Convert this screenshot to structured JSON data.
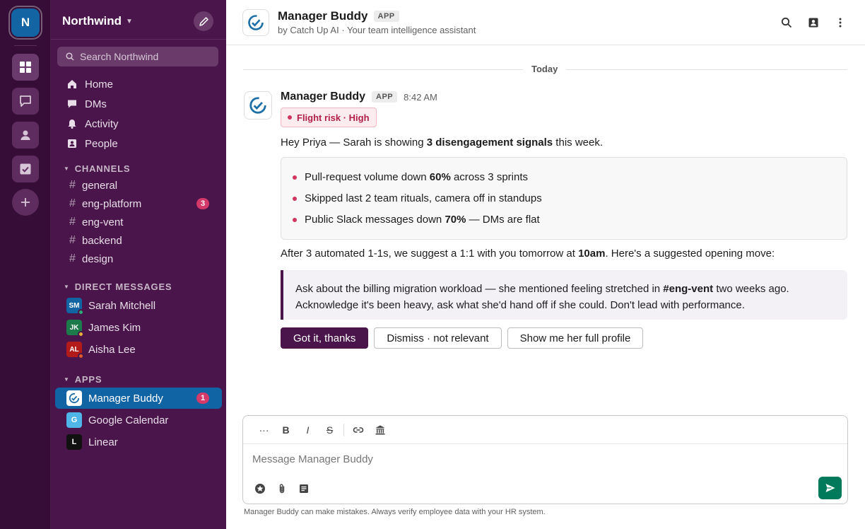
{
  "workspace": {
    "initial": "N",
    "name": "Northwind"
  },
  "search": {
    "placeholder": "Search Northwind"
  },
  "nav": [
    {
      "label": "Home",
      "icon": "home-icon"
    },
    {
      "label": "DMs",
      "icon": "chat-bubble-icon"
    },
    {
      "label": "Activity",
      "icon": "bell-icon"
    },
    {
      "label": "People",
      "icon": "contact-card-icon"
    }
  ],
  "channels": {
    "title": "CHANNELS",
    "items": [
      {
        "name": "general",
        "badge": ""
      },
      {
        "name": "eng-platform",
        "badge": "3"
      },
      {
        "name": "eng-vent",
        "badge": ""
      },
      {
        "name": "backend",
        "badge": ""
      },
      {
        "name": "design",
        "badge": ""
      }
    ]
  },
  "direct_messages": {
    "title": "DIRECT MESSAGES",
    "items": [
      {
        "initials": "SM",
        "name": "Sarah Mitchell",
        "color": "#1264a3",
        "status_color": "#2bac76"
      },
      {
        "initials": "JK",
        "name": "James Kim",
        "color": "#1d7a4a",
        "status_color": "#e8b03a"
      },
      {
        "initials": "AL",
        "name": "Aisha Lee",
        "color": "#b31b1b",
        "status_color": "#e05a2b"
      }
    ]
  },
  "apps": {
    "title": "APPS",
    "items": [
      {
        "initial": "",
        "name": "Manager Buddy",
        "badge": "1",
        "active": true
      },
      {
        "initial": "G",
        "name": "Google Calendar",
        "badge": "",
        "active": false
      },
      {
        "initial": "L",
        "name": "Linear",
        "badge": "",
        "active": false
      }
    ]
  },
  "header": {
    "title": "Manager Buddy",
    "tag": "APP",
    "subtitle": "by Catch Up AI · Your team intelligence assistant"
  },
  "divider_label": "Today",
  "message": {
    "author": "Manager Buddy",
    "tag": "APP",
    "time": "8:42 AM",
    "risk_label": "Flight risk · High",
    "intro_pre": "Hey Priya — Sarah is showing ",
    "intro_bold": "3 disengagement signals",
    "intro_post": " this week.",
    "bullets": [
      {
        "pre": "Pull-request volume down ",
        "bold": "60%",
        "post": " across 3 sprints"
      },
      {
        "pre": "Skipped last 2 team rituals, camera off in standups",
        "bold": "",
        "post": ""
      },
      {
        "pre": "Public Slack messages down ",
        "bold": "70%",
        "post": " — DMs are flat"
      }
    ],
    "suggest_pre": "After 3 automated 1-1s, we suggest a 1:1 with you tomorrow at ",
    "suggest_bold": "10am",
    "suggest_post": ". Here's a suggested opening move:",
    "quote_pre": "Ask about the billing migration workload — she mentioned feeling stretched in ",
    "quote_bold": "#eng-vent",
    "quote_post": " two weeks ago.",
    "quote_line2": "Acknowledge it's been heavy, ask what she'd hand off if she could. Don't lead with performance.",
    "actions": [
      "Got it, thanks",
      "Dismiss · not relevant",
      "Show me her full profile"
    ]
  },
  "composer": {
    "placeholder": "Message Manager Buddy",
    "toolbar": [
      "···",
      "B",
      "I",
      "S"
    ]
  },
  "disclaimer": "Manager Buddy can make mistakes. Always verify employee data with your HR system.",
  "colors": {
    "sidebar": "#4a154b",
    "rail": "#350d36",
    "active": "#1164a3",
    "badge": "#d33a6a",
    "send": "#007a5a"
  }
}
